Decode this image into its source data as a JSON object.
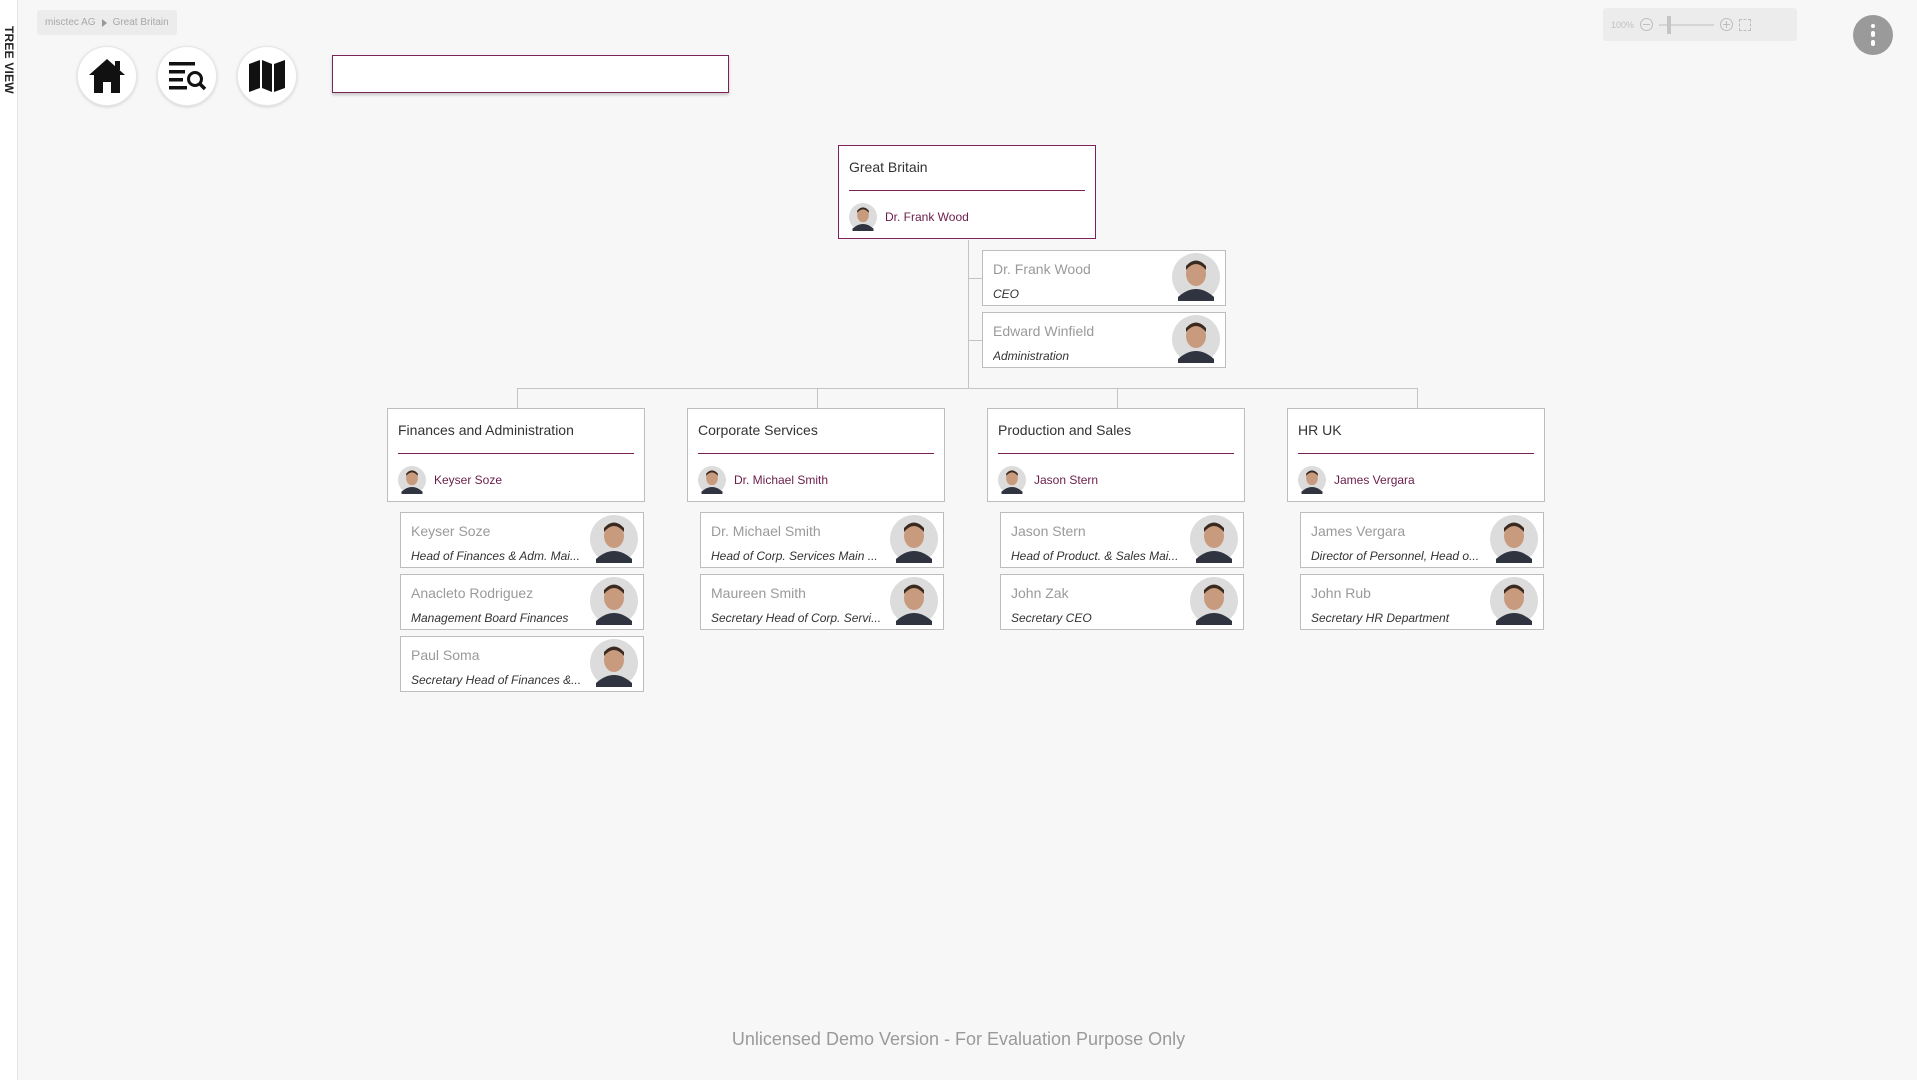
{
  "sidebar": {
    "label": "TREE VIEW"
  },
  "breadcrumb": {
    "items": [
      "misctec AG",
      "Great Britain"
    ]
  },
  "toolbar": {
    "buttons": [
      {
        "icon": "home-icon"
      },
      {
        "icon": "search-list-icon"
      },
      {
        "icon": "map-icon"
      }
    ],
    "search": {
      "value": "",
      "placeholder": ""
    }
  },
  "zoom": {
    "level": "100%"
  },
  "colors": {
    "accent": "#7a2356",
    "lines": "#c4c4c4",
    "background": "#f8f7f7"
  },
  "org": {
    "root": {
      "title": "Great Britain",
      "manager": "Dr. Frank Wood",
      "staff": [
        {
          "name": "Dr. Frank Wood",
          "role": "CEO"
        },
        {
          "name": "Edward Winfield",
          "role": "Administration"
        }
      ]
    },
    "units": [
      {
        "title": "Finances and Administration",
        "manager": "Keyser Soze",
        "staff": [
          {
            "name": "Keyser Soze",
            "role": "Head of Finances & Adm. Mai..."
          },
          {
            "name": "Anacleto Rodriguez",
            "role": "Management Board Finances"
          },
          {
            "name": "Paul Soma",
            "role": "Secretary Head of Finances &..."
          }
        ]
      },
      {
        "title": "Corporate Services",
        "manager": "Dr. Michael Smith",
        "staff": [
          {
            "name": "Dr. Michael Smith",
            "role": "Head of Corp. Services Main ..."
          },
          {
            "name": "Maureen Smith",
            "role": "Secretary Head of Corp. Servi..."
          }
        ]
      },
      {
        "title": "Production and Sales",
        "manager": "Jason Stern",
        "staff": [
          {
            "name": "Jason Stern",
            "role": "Head of Product. & Sales Mai..."
          },
          {
            "name": "John Zak",
            "role": "Secretary CEO"
          }
        ]
      },
      {
        "title": "HR UK",
        "manager": "James Vergara",
        "staff": [
          {
            "name": "James Vergara",
            "role": "Director of Personnel, Head o..."
          },
          {
            "name": "John Rub",
            "role": "Secretary HR Department"
          }
        ]
      }
    ]
  },
  "footer": {
    "note": "Unlicensed Demo Version - For Evaluation Purpose Only"
  }
}
